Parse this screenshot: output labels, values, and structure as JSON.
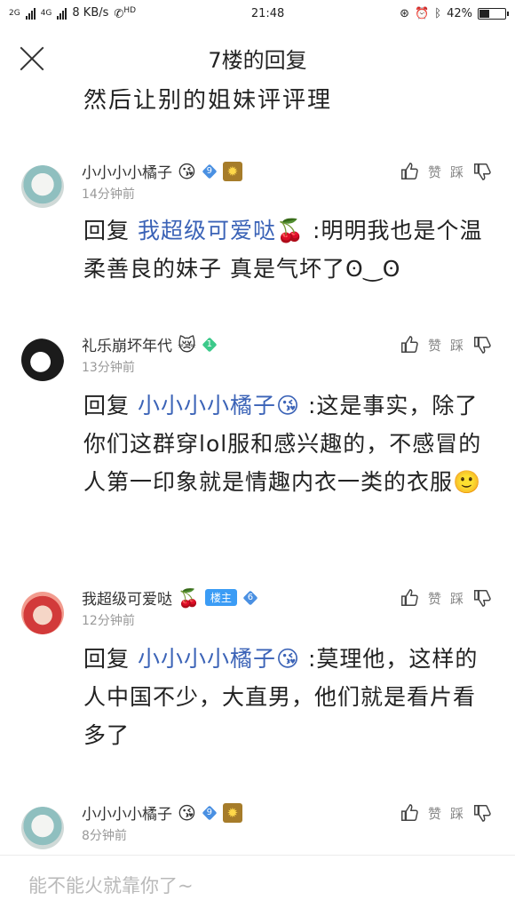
{
  "status": {
    "network": "2G",
    "network2": "4G",
    "speed": "8 KB/s",
    "hd": "HD",
    "time": "21:48",
    "battery": "42%",
    "battery_level": 0.42
  },
  "header": {
    "title": "7楼的回复"
  },
  "prev_text": "然后让别的姐妹评评理",
  "comments": [
    {
      "name": "小小小小橘子",
      "emoji": "😘",
      "level": "9",
      "time": "14分钟前",
      "reply_prefix": "回复",
      "mention": "我超级可爱哒🍒",
      "text": " :明明我也是个温柔善良的妹子 真是气坏了ʘ‿ʘ"
    },
    {
      "name": "礼乐崩坏年代",
      "emoji": "😿",
      "level": "1",
      "time": "13分钟前",
      "reply_prefix": "回复",
      "mention": "小小小小橘子😘",
      "text": " :这是事实，除了你们这群穿lol服和感兴趣的，不感冒的人第一印象就是情趣内衣一类的衣服🙂"
    },
    {
      "name": "我超级可爱哒",
      "emoji": "🍒",
      "badge": "楼主",
      "level": "6",
      "time": "12分钟前",
      "reply_prefix": "回复",
      "mention": "小小小小橘子😘",
      "text": " :莫理他，这样的人中国不少，大直男，他们就是看片看多了"
    },
    {
      "name": "小小小小橘子",
      "emoji": "😘",
      "level": "9",
      "time": "8分钟前"
    }
  ],
  "actions": {
    "like": "赞",
    "dislike": "踩"
  },
  "input": {
    "placeholder": "能不能火就靠你了~"
  },
  "icons": [
    "close-icon",
    "thumb-up-icon",
    "thumb-down-icon",
    "diamond-level-icon",
    "sun-badge-icon"
  ]
}
